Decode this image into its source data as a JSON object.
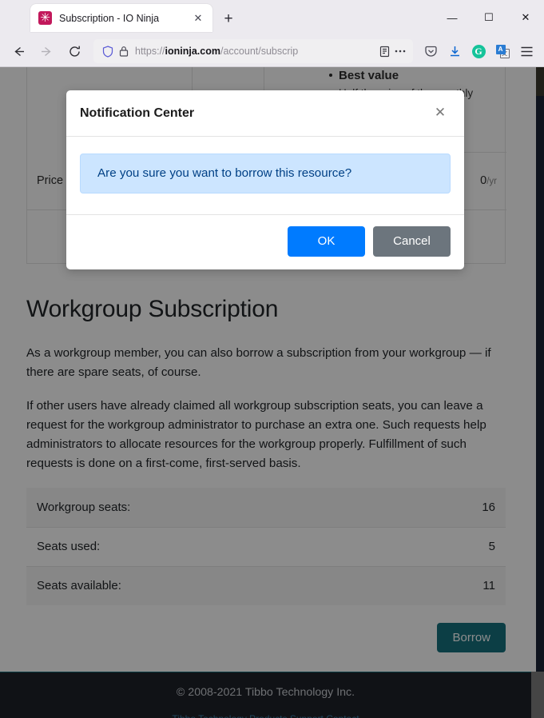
{
  "browser": {
    "tab": {
      "title": "Subscription - IO Ninja",
      "favicon_glyph": "✳",
      "close_glyph": "✕"
    },
    "new_tab_glyph": "+",
    "window_controls": {
      "minimize": "—",
      "maximize": "☐",
      "close": "✕"
    },
    "nav": {
      "back_label": "Back",
      "forward_label": "Forward",
      "reload_label": "Reload"
    },
    "url": {
      "scheme": "https://",
      "host": "ioninja.com",
      "path": "/account/subscrip",
      "full": "https://ioninja.com/account/subscrip"
    },
    "toolbar_icons": [
      "shield-icon",
      "lock-icon",
      "reader-view-icon",
      "page-actions-icon",
      "pocket-icon",
      "downloads-icon",
      "grammarly-icon",
      "translate-icon",
      "app-menu-icon"
    ],
    "grammarly_letter": "G",
    "translate_front_letter": "A",
    "translate_back_letter": "文"
  },
  "page": {
    "pricing": {
      "bullet_title": "Best value",
      "bullet_sub": "Half the price of the monthly",
      "price_label": "Price",
      "price_value": "0",
      "price_unit": "/yr"
    },
    "title": "Workgroup Subscription",
    "paragraphs": [
      "As a workgroup member, you can also borrow a subscription from your workgroup — if there are spare seats, of course.",
      "If other users have already claimed all workgroup subscription seats, you can leave a request for the workgroup administrator to purchase an extra one. Such requests help administrators to allocate resources for the workgroup properly. Fulfillment of such requests is done on a first-come, first-served basis."
    ],
    "seats": [
      {
        "label": "Workgroup seats:",
        "value": "16"
      },
      {
        "label": "Seats used:",
        "value": "5"
      },
      {
        "label": "Seats available:",
        "value": "11"
      }
    ],
    "borrow_button": "Borrow",
    "footer": {
      "copyright": "© 2008-2021 Tibbo Technology Inc.",
      "links_hint": "Tibbo Technology  Products  Support  Contact"
    }
  },
  "modal": {
    "title": "Notification Center",
    "close_glyph": "✕",
    "message": "Are you sure you want to borrow this resource?",
    "ok_label": "OK",
    "cancel_label": "Cancel"
  },
  "colors": {
    "accent_teal": "#17727f",
    "primary_blue": "#007bff",
    "secondary_gray": "#6c757d",
    "alert_bg": "#cce5ff",
    "alert_text": "#004085",
    "footer_bg": "#1e2229",
    "favicon_red": "#c2185b"
  }
}
